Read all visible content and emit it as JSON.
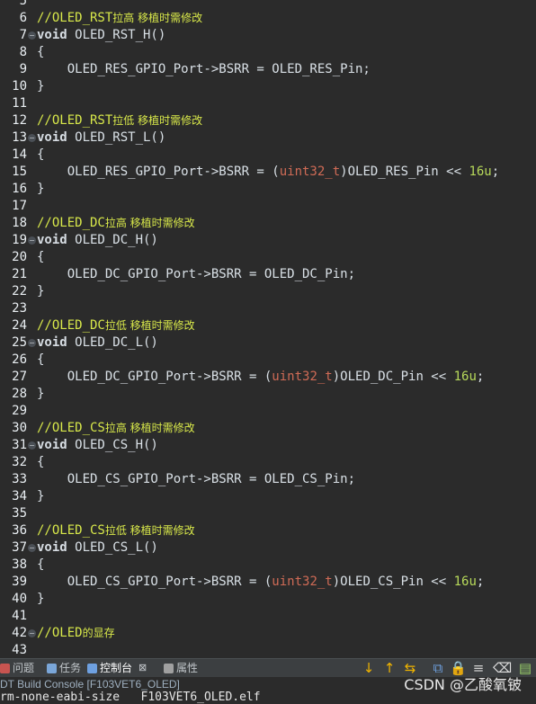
{
  "editor": {
    "lines": [
      {
        "num": "5",
        "segs": []
      },
      {
        "num": "6",
        "segs": [
          {
            "c": "comment",
            "t": "//OLED_RST"
          },
          {
            "c": "comment cn",
            "t": "拉高 移植时需修改"
          }
        ]
      },
      {
        "num": "7",
        "fold": true,
        "segs": [
          {
            "c": "kw",
            "t": "void"
          },
          {
            "c": "",
            "t": " OLED_RST_H()"
          }
        ]
      },
      {
        "num": "8",
        "segs": [
          {
            "c": "",
            "t": "{"
          }
        ]
      },
      {
        "num": "9",
        "segs": [
          {
            "c": "",
            "t": "    OLED_RES_GPIO_Port->BSRR = OLED_RES_Pin;"
          }
        ]
      },
      {
        "num": "10",
        "segs": [
          {
            "c": "",
            "t": "}"
          }
        ]
      },
      {
        "num": "11",
        "segs": []
      },
      {
        "num": "12",
        "segs": [
          {
            "c": "comment",
            "t": "//OLED_RST"
          },
          {
            "c": "comment cn",
            "t": "拉低 移植时需修改"
          }
        ]
      },
      {
        "num": "13",
        "fold": true,
        "segs": [
          {
            "c": "kw",
            "t": "void"
          },
          {
            "c": "",
            "t": " OLED_RST_L()"
          }
        ]
      },
      {
        "num": "14",
        "segs": [
          {
            "c": "",
            "t": "{"
          }
        ]
      },
      {
        "num": "15",
        "segs": [
          {
            "c": "",
            "t": "    OLED_RES_GPIO_Port->BSRR = ("
          },
          {
            "c": "type",
            "t": "uint32_t"
          },
          {
            "c": "",
            "t": ")OLED_RES_Pin << "
          },
          {
            "c": "num",
            "t": "16u"
          },
          {
            "c": "",
            "t": ";"
          }
        ]
      },
      {
        "num": "16",
        "segs": [
          {
            "c": "",
            "t": "}"
          }
        ]
      },
      {
        "num": "17",
        "segs": []
      },
      {
        "num": "18",
        "segs": [
          {
            "c": "comment",
            "t": "//OLED_DC"
          },
          {
            "c": "comment cn",
            "t": "拉高 移植时需修改"
          }
        ]
      },
      {
        "num": "19",
        "fold": true,
        "segs": [
          {
            "c": "kw",
            "t": "void"
          },
          {
            "c": "",
            "t": " OLED_DC_H()"
          }
        ]
      },
      {
        "num": "20",
        "segs": [
          {
            "c": "",
            "t": "{"
          }
        ]
      },
      {
        "num": "21",
        "segs": [
          {
            "c": "",
            "t": "    OLED_DC_GPIO_Port->BSRR = OLED_DC_Pin;"
          }
        ]
      },
      {
        "num": "22",
        "segs": [
          {
            "c": "",
            "t": "}"
          }
        ]
      },
      {
        "num": "23",
        "segs": []
      },
      {
        "num": "24",
        "segs": [
          {
            "c": "comment",
            "t": "//OLED_DC"
          },
          {
            "c": "comment cn",
            "t": "拉低 移植时需修改"
          }
        ]
      },
      {
        "num": "25",
        "fold": true,
        "segs": [
          {
            "c": "kw",
            "t": "void"
          },
          {
            "c": "",
            "t": " OLED_DC_L()"
          }
        ]
      },
      {
        "num": "26",
        "segs": [
          {
            "c": "",
            "t": "{"
          }
        ]
      },
      {
        "num": "27",
        "segs": [
          {
            "c": "",
            "t": "    OLED_DC_GPIO_Port->BSRR = ("
          },
          {
            "c": "type",
            "t": "uint32_t"
          },
          {
            "c": "",
            "t": ")OLED_DC_Pin << "
          },
          {
            "c": "num",
            "t": "16u"
          },
          {
            "c": "",
            "t": ";"
          }
        ]
      },
      {
        "num": "28",
        "segs": [
          {
            "c": "",
            "t": "}"
          }
        ]
      },
      {
        "num": "29",
        "segs": []
      },
      {
        "num": "30",
        "segs": [
          {
            "c": "comment",
            "t": "//OLED_CS"
          },
          {
            "c": "comment cn",
            "t": "拉高 移植时需修改"
          }
        ]
      },
      {
        "num": "31",
        "fold": true,
        "segs": [
          {
            "c": "kw",
            "t": "void"
          },
          {
            "c": "",
            "t": " OLED_CS_H()"
          }
        ]
      },
      {
        "num": "32",
        "segs": [
          {
            "c": "",
            "t": "{"
          }
        ]
      },
      {
        "num": "33",
        "segs": [
          {
            "c": "",
            "t": "    OLED_CS_GPIO_Port->BSRR = OLED_CS_Pin;"
          }
        ]
      },
      {
        "num": "34",
        "segs": [
          {
            "c": "",
            "t": "}"
          }
        ]
      },
      {
        "num": "35",
        "segs": []
      },
      {
        "num": "36",
        "segs": [
          {
            "c": "comment",
            "t": "//OLED_CS"
          },
          {
            "c": "comment cn",
            "t": "拉低 移植时需修改"
          }
        ]
      },
      {
        "num": "37",
        "fold": true,
        "segs": [
          {
            "c": "kw",
            "t": "void"
          },
          {
            "c": "",
            "t": " OLED_CS_L()"
          }
        ]
      },
      {
        "num": "38",
        "segs": [
          {
            "c": "",
            "t": "{"
          }
        ]
      },
      {
        "num": "39",
        "segs": [
          {
            "c": "",
            "t": "    OLED_CS_GPIO_Port->BSRR = ("
          },
          {
            "c": "type",
            "t": "uint32_t"
          },
          {
            "c": "",
            "t": ")OLED_CS_Pin << "
          },
          {
            "c": "num",
            "t": "16u"
          },
          {
            "c": "",
            "t": ";"
          }
        ]
      },
      {
        "num": "40",
        "segs": [
          {
            "c": "",
            "t": "}"
          }
        ]
      },
      {
        "num": "41",
        "segs": []
      },
      {
        "num": "42",
        "fold": true,
        "segs": [
          {
            "c": "comment",
            "t": "//OLED"
          },
          {
            "c": "comment cn",
            "t": "的显存"
          }
        ]
      },
      {
        "num": "43",
        "segs": []
      }
    ]
  },
  "panel": {
    "tabs": [
      {
        "label": "问题",
        "icon": "problems-icon",
        "color": "#c75450"
      },
      {
        "label": "任务",
        "icon": "tasks-icon",
        "color": "#7aa6d8"
      },
      {
        "label": "控制台",
        "icon": "console-icon",
        "color": "#6ea0e0",
        "active": true,
        "close": "⊠"
      },
      {
        "label": "属性",
        "icon": "properties-icon",
        "color": "#a0a0a0"
      }
    ],
    "toolbar_icons": [
      {
        "name": "next-annotation-icon",
        "glyph": "↓",
        "color": "#f0b400"
      },
      {
        "name": "previous-annotation-icon",
        "glyph": "↑",
        "color": "#f0b400"
      },
      {
        "name": "sync-console-icon",
        "glyph": "⇆",
        "color": "#f0b400"
      },
      {
        "name": "new-console-icon",
        "glyph": "⧉",
        "color": "#6ea0e0"
      },
      {
        "name": "pin-console-icon",
        "glyph": "🔒",
        "color": "#f0b400"
      },
      {
        "name": "word-wrap-icon",
        "glyph": "≡",
        "color": "#d0d0d0"
      },
      {
        "name": "clear-console-icon",
        "glyph": "⌫",
        "color": "#e0e0e0"
      },
      {
        "name": "display-console-icon",
        "glyph": "▤",
        "color": "#9ad06a"
      }
    ],
    "console_title": "DT Build Console [F103VET6_OLED]",
    "console_line": "rm-none-eabi-size   F103VET6_OLED.elf"
  },
  "watermark": "CSDN @乙酸氧铍"
}
